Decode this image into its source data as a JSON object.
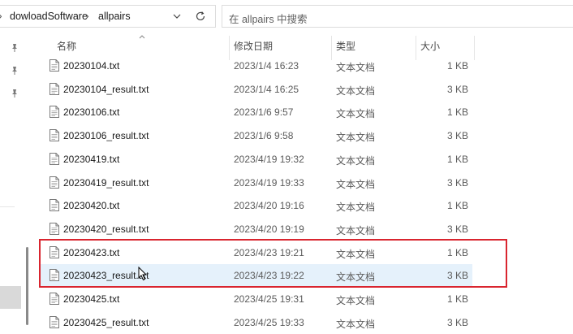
{
  "address_bar": {
    "breadcrumb": [
      {
        "label": "dowloadSoftware"
      },
      {
        "label": "allpairs"
      }
    ],
    "separator": "›",
    "dropdown_icon": "chevron-down-icon",
    "refresh_icon": "refresh-icon"
  },
  "search": {
    "placeholder": "在 allpairs 中搜索"
  },
  "columns": {
    "name": "名称",
    "date": "修改日期",
    "type": "类型",
    "size": "大小"
  },
  "files": [
    {
      "name": "20230104.txt",
      "date": "2023/1/4 16:23",
      "type": "文本文档",
      "size": "1 KB"
    },
    {
      "name": "20230104_result.txt",
      "date": "2023/1/4 16:25",
      "type": "文本文档",
      "size": "3 KB"
    },
    {
      "name": "20230106.txt",
      "date": "2023/1/6 9:57",
      "type": "文本文档",
      "size": "1 KB"
    },
    {
      "name": "20230106_result.txt",
      "date": "2023/1/6 9:58",
      "type": "文本文档",
      "size": "3 KB"
    },
    {
      "name": "20230419.txt",
      "date": "2023/4/19 19:32",
      "type": "文本文档",
      "size": "1 KB"
    },
    {
      "name": "20230419_result.txt",
      "date": "2023/4/19 19:33",
      "type": "文本文档",
      "size": "3 KB"
    },
    {
      "name": "20230420.txt",
      "date": "2023/4/20 19:16",
      "type": "文本文档",
      "size": "1 KB"
    },
    {
      "name": "20230420_result.txt",
      "date": "2023/4/20 19:19",
      "type": "文本文档",
      "size": "3 KB"
    },
    {
      "name": "20230423.txt",
      "date": "2023/4/23 19:21",
      "type": "文本文档",
      "size": "1 KB"
    },
    {
      "name": "20230423_result.txt",
      "date": "2023/4/23 19:22",
      "type": "文本文档",
      "size": "3 KB",
      "hovered": true
    },
    {
      "name": "20230425.txt",
      "date": "2023/4/25 19:31",
      "type": "文本文档",
      "size": "1 KB"
    },
    {
      "name": "20230425_result.txt",
      "date": "2023/4/25 19:33",
      "type": "文本文档",
      "size": "3 KB"
    }
  ],
  "annotation": {
    "color": "#d9252f",
    "highlighted_files": [
      "20230423.txt",
      "20230423_result.txt"
    ]
  },
  "colors": {
    "hover_row": "#e5f1fb",
    "annotation_border": "#d9252f"
  },
  "icons": {
    "file": "text-file-icon",
    "pin": "pin-icon"
  }
}
